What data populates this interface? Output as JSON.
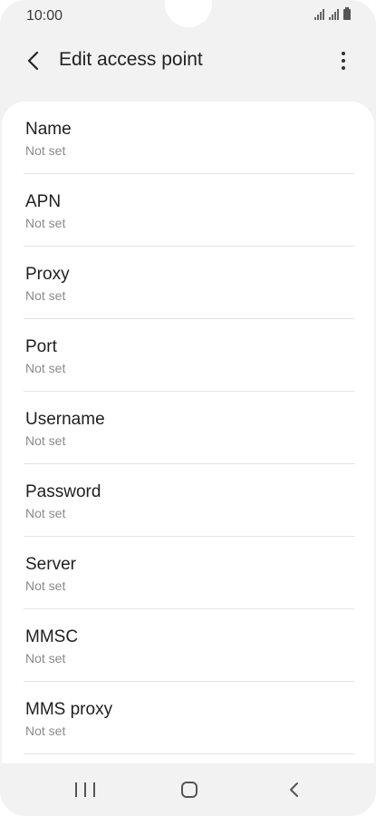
{
  "status_bar": {
    "time": "10:00"
  },
  "app_bar": {
    "title": "Edit access point",
    "back_icon": "chevron-left-icon",
    "more_icon": "more-vertical-icon"
  },
  "settings": {
    "items": [
      {
        "label": "Name",
        "value": "Not set"
      },
      {
        "label": "APN",
        "value": "Not set"
      },
      {
        "label": "Proxy",
        "value": "Not set"
      },
      {
        "label": "Port",
        "value": "Not set"
      },
      {
        "label": "Username",
        "value": "Not set"
      },
      {
        "label": "Password",
        "value": "Not set"
      },
      {
        "label": "Server",
        "value": "Not set"
      },
      {
        "label": "MMSC",
        "value": "Not set"
      },
      {
        "label": "MMS proxy",
        "value": "Not set"
      }
    ]
  },
  "nav_bar": {
    "recent_icon": "recent-apps-icon",
    "home_icon": "home-icon",
    "back_icon": "back-icon"
  }
}
